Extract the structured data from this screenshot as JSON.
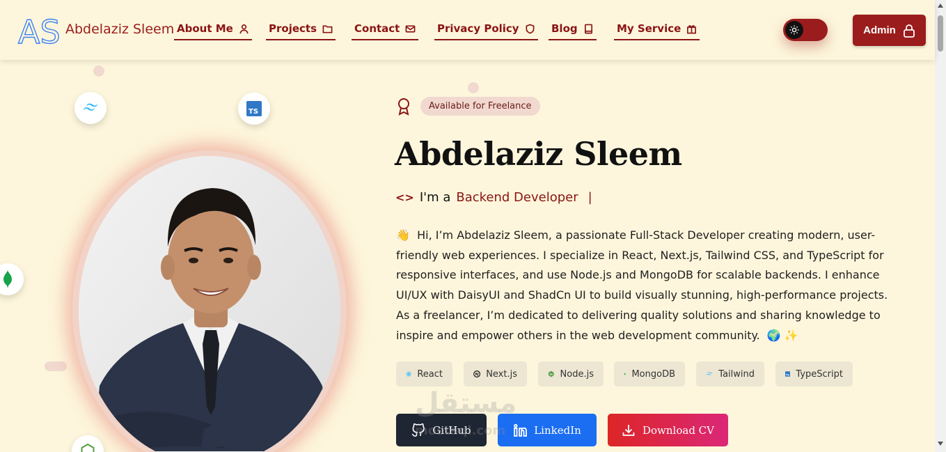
{
  "header": {
    "brand_name": "Abdelaziz Sleem",
    "logo_text": "AS",
    "nav": [
      {
        "label": "About Me",
        "icon": "user-icon"
      },
      {
        "label": "Projects",
        "icon": "folder-icon"
      },
      {
        "label": "Contact",
        "icon": "mail-icon"
      },
      {
        "label": "Privacy Policy",
        "icon": "shield-icon"
      },
      {
        "label": "Blog",
        "icon": "book-icon"
      },
      {
        "label": "My Service",
        "icon": "gift-icon"
      }
    ],
    "theme_toggle_icon": "sun-icon",
    "admin_label": "Admin",
    "admin_icon": "lock-icon"
  },
  "hero": {
    "availability": "Available for Freelance",
    "name": "Abdelaziz Sleem",
    "role_prefix": "I'm a",
    "role_title": "Backend Developer",
    "role_cursor": "|",
    "bio_emoji_start": "👋",
    "bio": "Hi, I’m Abdelaziz Sleem, a passionate Full-Stack Developer creating modern, user-friendly web experiences. I specialize in React, Next.js, Tailwind CSS, and TypeScript for responsive interfaces, and use Node.js and MongoDB for scalable backends. I enhance UI/UX with DaisyUI and ShadCn UI to build visually stunning, high-performance projects. As a freelancer, I’m dedicated to delivering quality solutions and sharing knowledge to inspire and empower others in the web development community.",
    "bio_emoji_end": "🌍 ✨",
    "tech": [
      {
        "label": "React",
        "icon": "react-icon"
      },
      {
        "label": "Next.js",
        "icon": "nextjs-icon"
      },
      {
        "label": "Node.js",
        "icon": "nodejs-icon"
      },
      {
        "label": "MongoDB",
        "icon": "mongodb-icon"
      },
      {
        "label": "Tailwind",
        "icon": "tailwind-icon"
      },
      {
        "label": "TypeScript",
        "icon": "typescript-icon"
      }
    ],
    "buttons": {
      "github": "GitHub",
      "linkedin": "LinkedIn",
      "download_cv": "Download CV"
    }
  },
  "floating_badges": [
    "tailwind-icon",
    "typescript-icon",
    "mongodb-icon",
    "nodejs-icon"
  ],
  "watermark": {
    "text": "مستقل",
    "sub": "mostaql.com"
  },
  "colors": {
    "background": "#fdf6dc",
    "accent": "#9b1c1c",
    "github_btn": "#1e2533",
    "linkedin_btn": "#1b6df2",
    "cv_btn_from": "#dc2626",
    "cv_btn_to": "#db2777"
  }
}
